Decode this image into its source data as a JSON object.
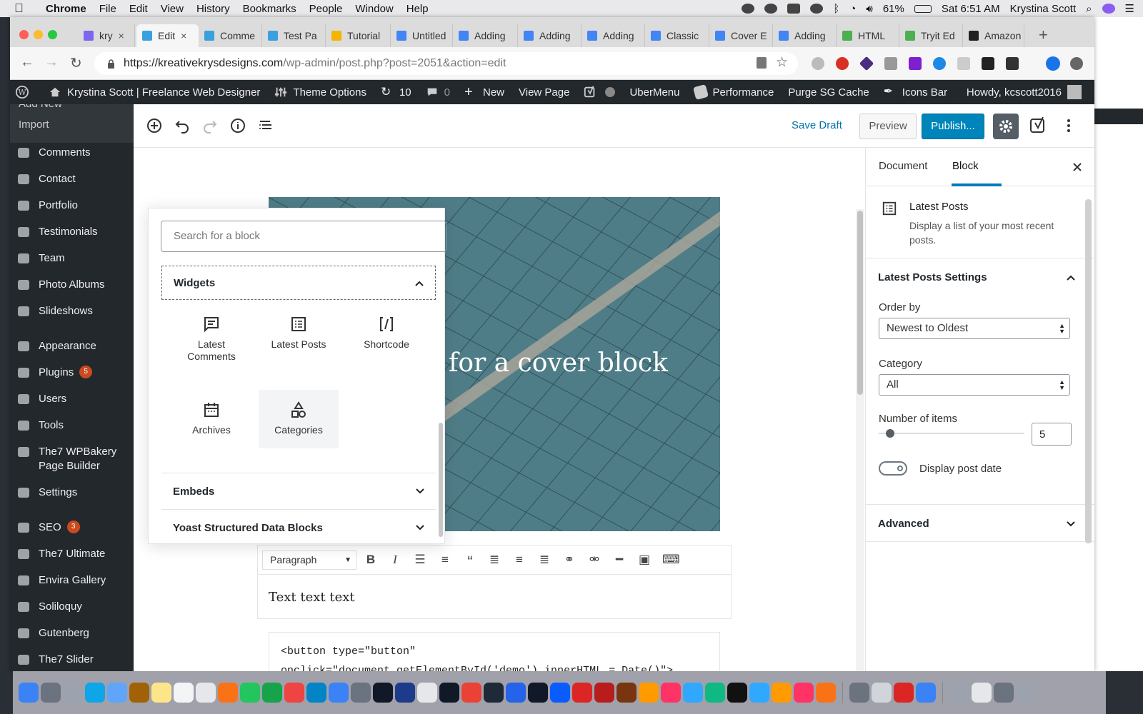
{
  "menubar": {
    "app": "Chrome",
    "items": [
      "File",
      "Edit",
      "View",
      "History",
      "Bookmarks",
      "People",
      "Window",
      "Help"
    ],
    "battery": "61%",
    "clock": "Sat 6:51 AM",
    "user": "Krystina Scott"
  },
  "tabs": [
    {
      "label": "kry",
      "icon": "mail-icon",
      "color": "#7b68ee"
    },
    {
      "label": "Edit",
      "icon": "wp-icon",
      "color": "#3aa0e0",
      "active": true
    },
    {
      "label": "Comme",
      "icon": "wp-icon",
      "color": "#3aa0e0"
    },
    {
      "label": "Test Pa",
      "icon": "wp-icon",
      "color": "#3aa0e0"
    },
    {
      "label": "Tutorial",
      "icon": "drive-icon",
      "color": "#f4b400"
    },
    {
      "label": "Untitled",
      "icon": "docs-icon",
      "color": "#4285f4"
    },
    {
      "label": "Adding",
      "icon": "docs-icon",
      "color": "#4285f4"
    },
    {
      "label": "Adding",
      "icon": "docs-icon",
      "color": "#4285f4"
    },
    {
      "label": "Adding",
      "icon": "docs-icon",
      "color": "#4285f4"
    },
    {
      "label": "Classic",
      "icon": "docs-icon",
      "color": "#4285f4"
    },
    {
      "label": "Cover E",
      "icon": "docs-icon",
      "color": "#4285f4"
    },
    {
      "label": "Adding",
      "icon": "docs-icon",
      "color": "#4285f4"
    },
    {
      "label": "HTML",
      "icon": "w3-icon",
      "color": "#4caf50"
    },
    {
      "label": "Tryit Ed",
      "icon": "w3-icon",
      "color": "#4caf50"
    },
    {
      "label": "Amazon",
      "icon": "amazon-icon",
      "color": "#222"
    }
  ],
  "address": {
    "host": "https://kreativekrysdesigns.com",
    "path": "/wp-admin/post.php?post=2051&action=edit"
  },
  "adminbar": {
    "site": "Krystina Scott | Freelance Web Designer",
    "theme_options": "Theme Options",
    "updates": "10",
    "comments": "0",
    "new": "New",
    "view_page": "View Page",
    "ubermenu": "UberMenu",
    "performance": "Performance",
    "purge": "Purge SG Cache",
    "icons_bar": "Icons Bar",
    "howdy": "Howdy, kcscott2016"
  },
  "sidebar": {
    "sub_items": [
      "Add New",
      "Import"
    ],
    "items": [
      {
        "label": "Comments"
      },
      {
        "label": "Contact"
      },
      {
        "label": "Portfolio"
      },
      {
        "label": "Testimonials"
      },
      {
        "label": "Team"
      },
      {
        "label": "Photo Albums"
      },
      {
        "label": "Slideshows"
      },
      {
        "label": "Appearance"
      },
      {
        "label": "Plugins",
        "badge": "5"
      },
      {
        "label": "Users"
      },
      {
        "label": "Tools"
      },
      {
        "label": "The7 WPBakery Page Builder"
      },
      {
        "label": "Settings"
      },
      {
        "label": "SEO",
        "badge": "3"
      },
      {
        "label": "The7 Ultimate"
      },
      {
        "label": "Envira Gallery"
      },
      {
        "label": "Soliloquy"
      },
      {
        "label": "Gutenberg"
      },
      {
        "label": "The7 Slider"
      }
    ]
  },
  "editor": {
    "save_draft": "Save Draft",
    "preview": "Preview",
    "publish": "Publish...",
    "cover_text": "for a cover block",
    "paragraph_select": "Paragraph",
    "text_block": "Text text text",
    "html_line1": "<button type=\"button\"",
    "html_line2": "onclick=\"document.getElementById('demo').innerHTML = Date()\">"
  },
  "inserter": {
    "search_placeholder": "Search for a block",
    "widgets_title": "Widgets",
    "blocks": [
      {
        "label": "Latest Comments",
        "icon": "comment-icon"
      },
      {
        "label": "Latest Posts",
        "icon": "list-icon"
      },
      {
        "label": "Shortcode",
        "icon": "shortcode-icon"
      },
      {
        "label": "Archives",
        "icon": "calendar-icon"
      },
      {
        "label": "Categories",
        "icon": "shapes-icon"
      }
    ],
    "embeds_title": "Embeds",
    "yoast_title": "Yoast Structured Data Blocks"
  },
  "inspector": {
    "tab_document": "Document",
    "tab_block": "Block",
    "block_title": "Latest Posts",
    "block_desc": "Display a list of your most recent posts.",
    "settings_title": "Latest Posts Settings",
    "order_label": "Order by",
    "order_value": "Newest to Oldest",
    "category_label": "Category",
    "category_value": "All",
    "number_label": "Number of items",
    "number_value": "5",
    "number_slider_fraction": 0.08,
    "display_date_label": "Display post date",
    "advanced_title": "Advanced"
  },
  "colors": {
    "wp_dark": "#23282d",
    "wp_blue": "#0085ba",
    "link_blue": "#0073aa",
    "badge_red": "#ca4a1f",
    "cover_teal": "#4f7d87"
  }
}
